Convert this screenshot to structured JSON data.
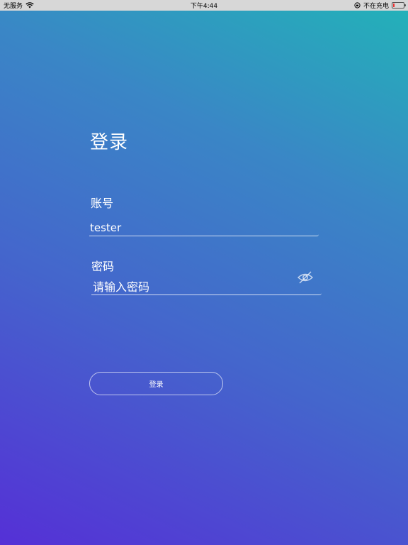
{
  "status_bar": {
    "carrier": "无服务",
    "time": "下午4:44",
    "charging_status": "不在充电",
    "icons": [
      "wifi-icon",
      "orientation-lock-icon",
      "battery-icon"
    ]
  },
  "login": {
    "title": "登录",
    "account_label": "账号",
    "account_value": "tester",
    "password_label": "密码",
    "password_placeholder": "请输入密码",
    "password_visibility_icon": "eye-off-icon",
    "submit_label": "登录"
  },
  "colors": {
    "gradient_top_right": "#22b3b8",
    "gradient_bottom_left": "#5530d6",
    "text": "#ffffff"
  }
}
